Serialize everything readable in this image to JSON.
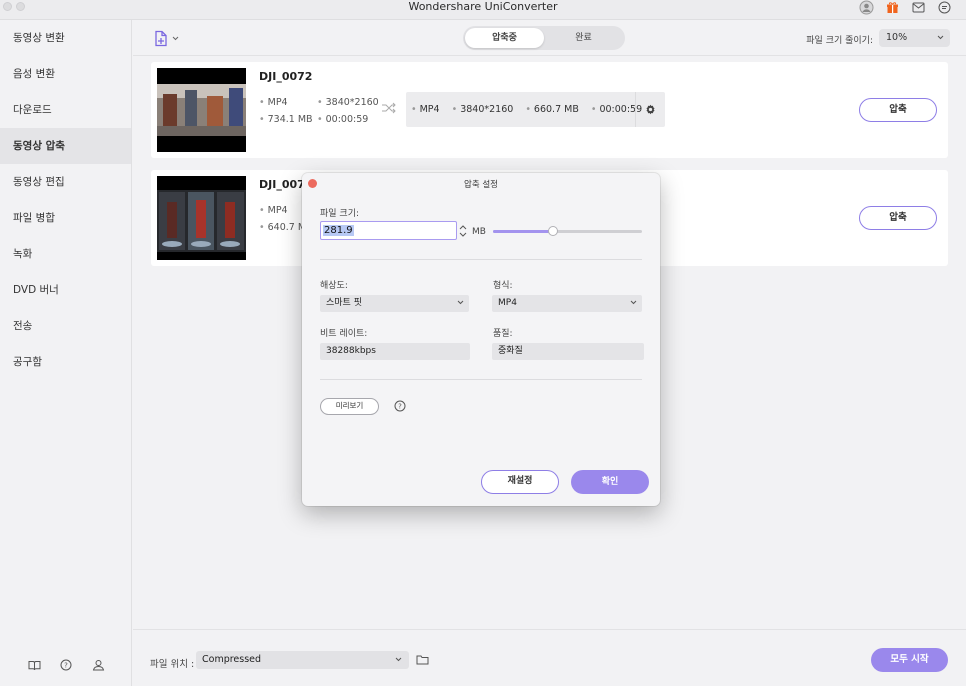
{
  "window": {
    "title": "Wondershare UniConverter"
  },
  "sidebar": {
    "items": [
      {
        "label": "동영상 변환"
      },
      {
        "label": "음성 변환"
      },
      {
        "label": "다운로드"
      },
      {
        "label": "동영상 압축"
      },
      {
        "label": "동영상 편집"
      },
      {
        "label": "파일 병합"
      },
      {
        "label": "녹화"
      },
      {
        "label": "DVD 버너"
      },
      {
        "label": "전송"
      },
      {
        "label": "공구함"
      }
    ],
    "active_index": 3
  },
  "topbar": {
    "tabs": [
      {
        "label": "압축중"
      },
      {
        "label": "완료"
      }
    ],
    "reduce_label": "파일 크기 줄이기:",
    "reduce_value": "10%"
  },
  "files": [
    {
      "name": "DJI_0072",
      "src_format": "MP4",
      "src_resolution": "3840*2160",
      "src_size": "734.1 MB",
      "src_duration": "00:00:59",
      "out_format": "MP4",
      "out_resolution": "3840*2160",
      "out_size": "660.7 MB",
      "out_duration": "00:00:59",
      "action": "압축"
    },
    {
      "name": "DJI_007",
      "src_format": "MP4",
      "src_size": "640.7 MB",
      "action": "압축"
    }
  ],
  "bottombar": {
    "location_label": "파일 위치 :",
    "location_value": "Compressed",
    "start_all": "모두 시작"
  },
  "dialog": {
    "title": "압축 설정",
    "file_size_label": "파일 크기:",
    "file_size_value": "281.9",
    "unit": "MB",
    "slider_fraction": 0.4,
    "resolution_label": "해상도:",
    "resolution_value": "스마트 핏",
    "format_label": "형식:",
    "format_value": "MP4",
    "bitrate_label": "비트 레이트:",
    "bitrate_value": "38288kbps",
    "quality_label": "품질:",
    "quality_value": "중화질",
    "preview_label": "미리보기",
    "reset_label": "재설정",
    "ok_label": "확인"
  },
  "colors": {
    "accent": "#9a88ec",
    "close": "#ec6a5e"
  }
}
